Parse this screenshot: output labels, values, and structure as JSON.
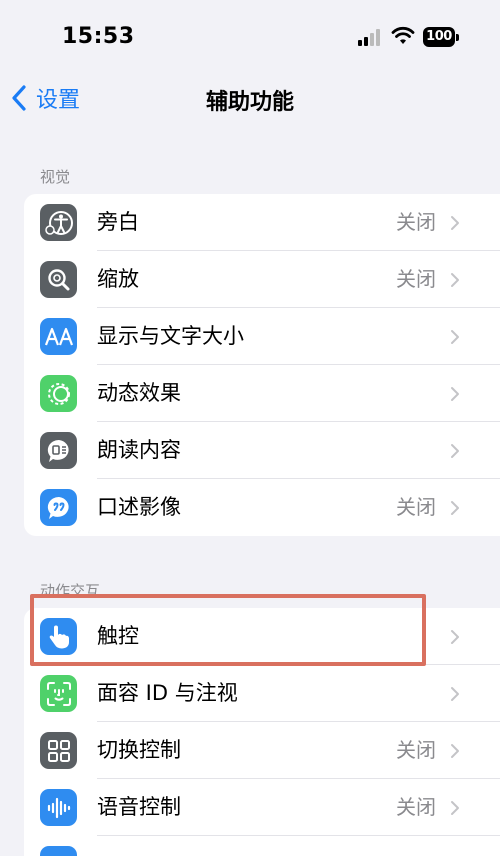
{
  "status_bar": {
    "time": "15:53",
    "battery": "100"
  },
  "nav": {
    "back_label": "设置",
    "title": "辅助功能"
  },
  "sections": [
    {
      "header": "视觉",
      "rows": [
        {
          "label": "旁白",
          "value": "关闭",
          "icon": "voiceover-icon",
          "color": "#5a5f63"
        },
        {
          "label": "缩放",
          "value": "关闭",
          "icon": "zoom-icon",
          "color": "#5a5f63"
        },
        {
          "label": "显示与文字大小",
          "value": "",
          "icon": "display-text-size-icon",
          "color": "#2f8cf0"
        },
        {
          "label": "动态效果",
          "value": "",
          "icon": "motion-icon",
          "color": "#4fd16a"
        },
        {
          "label": "朗读内容",
          "value": "",
          "icon": "spoken-content-icon",
          "color": "#5a5f63"
        },
        {
          "label": "口述影像",
          "value": "关闭",
          "icon": "audio-descriptions-icon",
          "color": "#2f8cf0"
        }
      ]
    },
    {
      "header": "动作交互",
      "rows": [
        {
          "label": "触控",
          "value": "",
          "icon": "touch-icon",
          "color": "#2f8cf0"
        },
        {
          "label": "面容 ID 与注视",
          "value": "",
          "icon": "face-id-icon",
          "color": "#4fd16a"
        },
        {
          "label": "切换控制",
          "value": "关闭",
          "icon": "switch-control-icon",
          "color": "#5a5f63"
        },
        {
          "label": "语音控制",
          "value": "关闭",
          "icon": "voice-control-icon",
          "color": "#2f8cf0"
        }
      ]
    }
  ]
}
